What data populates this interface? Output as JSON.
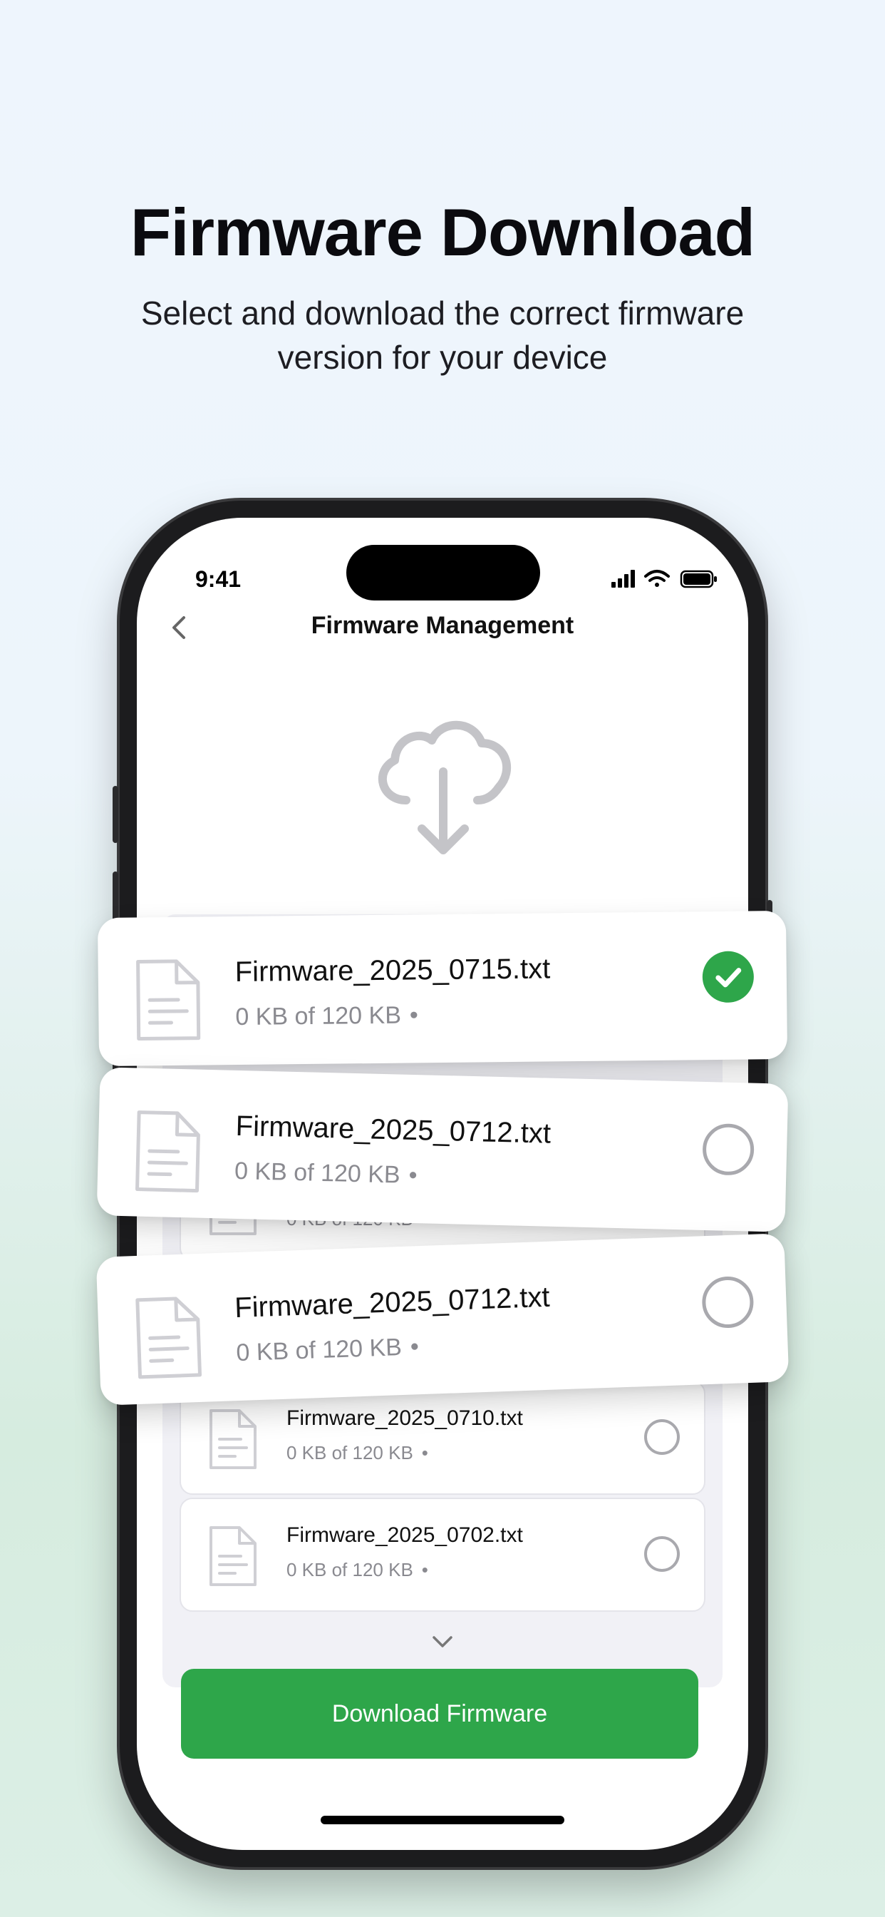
{
  "hero": {
    "title": "Firmware Download",
    "subtitle": "Select and download the correct firmware version for your device"
  },
  "status_bar": {
    "time": "9:41"
  },
  "nav": {
    "title": "Firmware Management",
    "back_icon": "chevron-left-icon"
  },
  "files": [
    {
      "name": "Firmware_2025_0715.txt",
      "size": "0 KB of 120 KB",
      "selected": true
    },
    {
      "name": "Firmware_2025_0712.txt",
      "size": "0 KB of 120 KB",
      "selected": false
    },
    {
      "name": "Firmware_2025_0712.txt",
      "size": "0 KB of 120 KB",
      "selected": false
    }
  ],
  "background_files": [
    {
      "name": "Firmware_2025_0710.txt",
      "size": "0 KB of 120 KB"
    },
    {
      "name": "Firmware_2025_0702.txt",
      "size": "0 KB of 120 KB"
    }
  ],
  "bullet": "•",
  "download_button": {
    "label": "Download Firmware"
  },
  "colors": {
    "accent": "#2ea64a",
    "muted_text": "#8a8a90"
  }
}
